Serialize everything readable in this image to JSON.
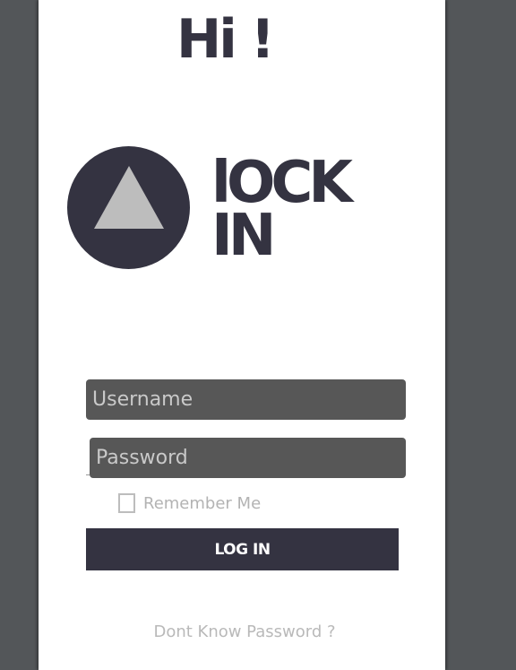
{
  "greeting": "Hi !",
  "logo": {
    "line1": "lOCK",
    "line2": "IN",
    "icon": "triangle-logo-icon"
  },
  "form": {
    "username_placeholder": "Username",
    "password_placeholder": "Password",
    "remember_label": "Remember Me",
    "remember_checked": false,
    "login_label": "LOG IN",
    "forgot_label": "Dont Know Password ?"
  },
  "colors": {
    "background": "#535659",
    "panel": "#ffffff",
    "brand": "#343341",
    "field": "#575757",
    "muted_text": "#b3b3b3"
  }
}
